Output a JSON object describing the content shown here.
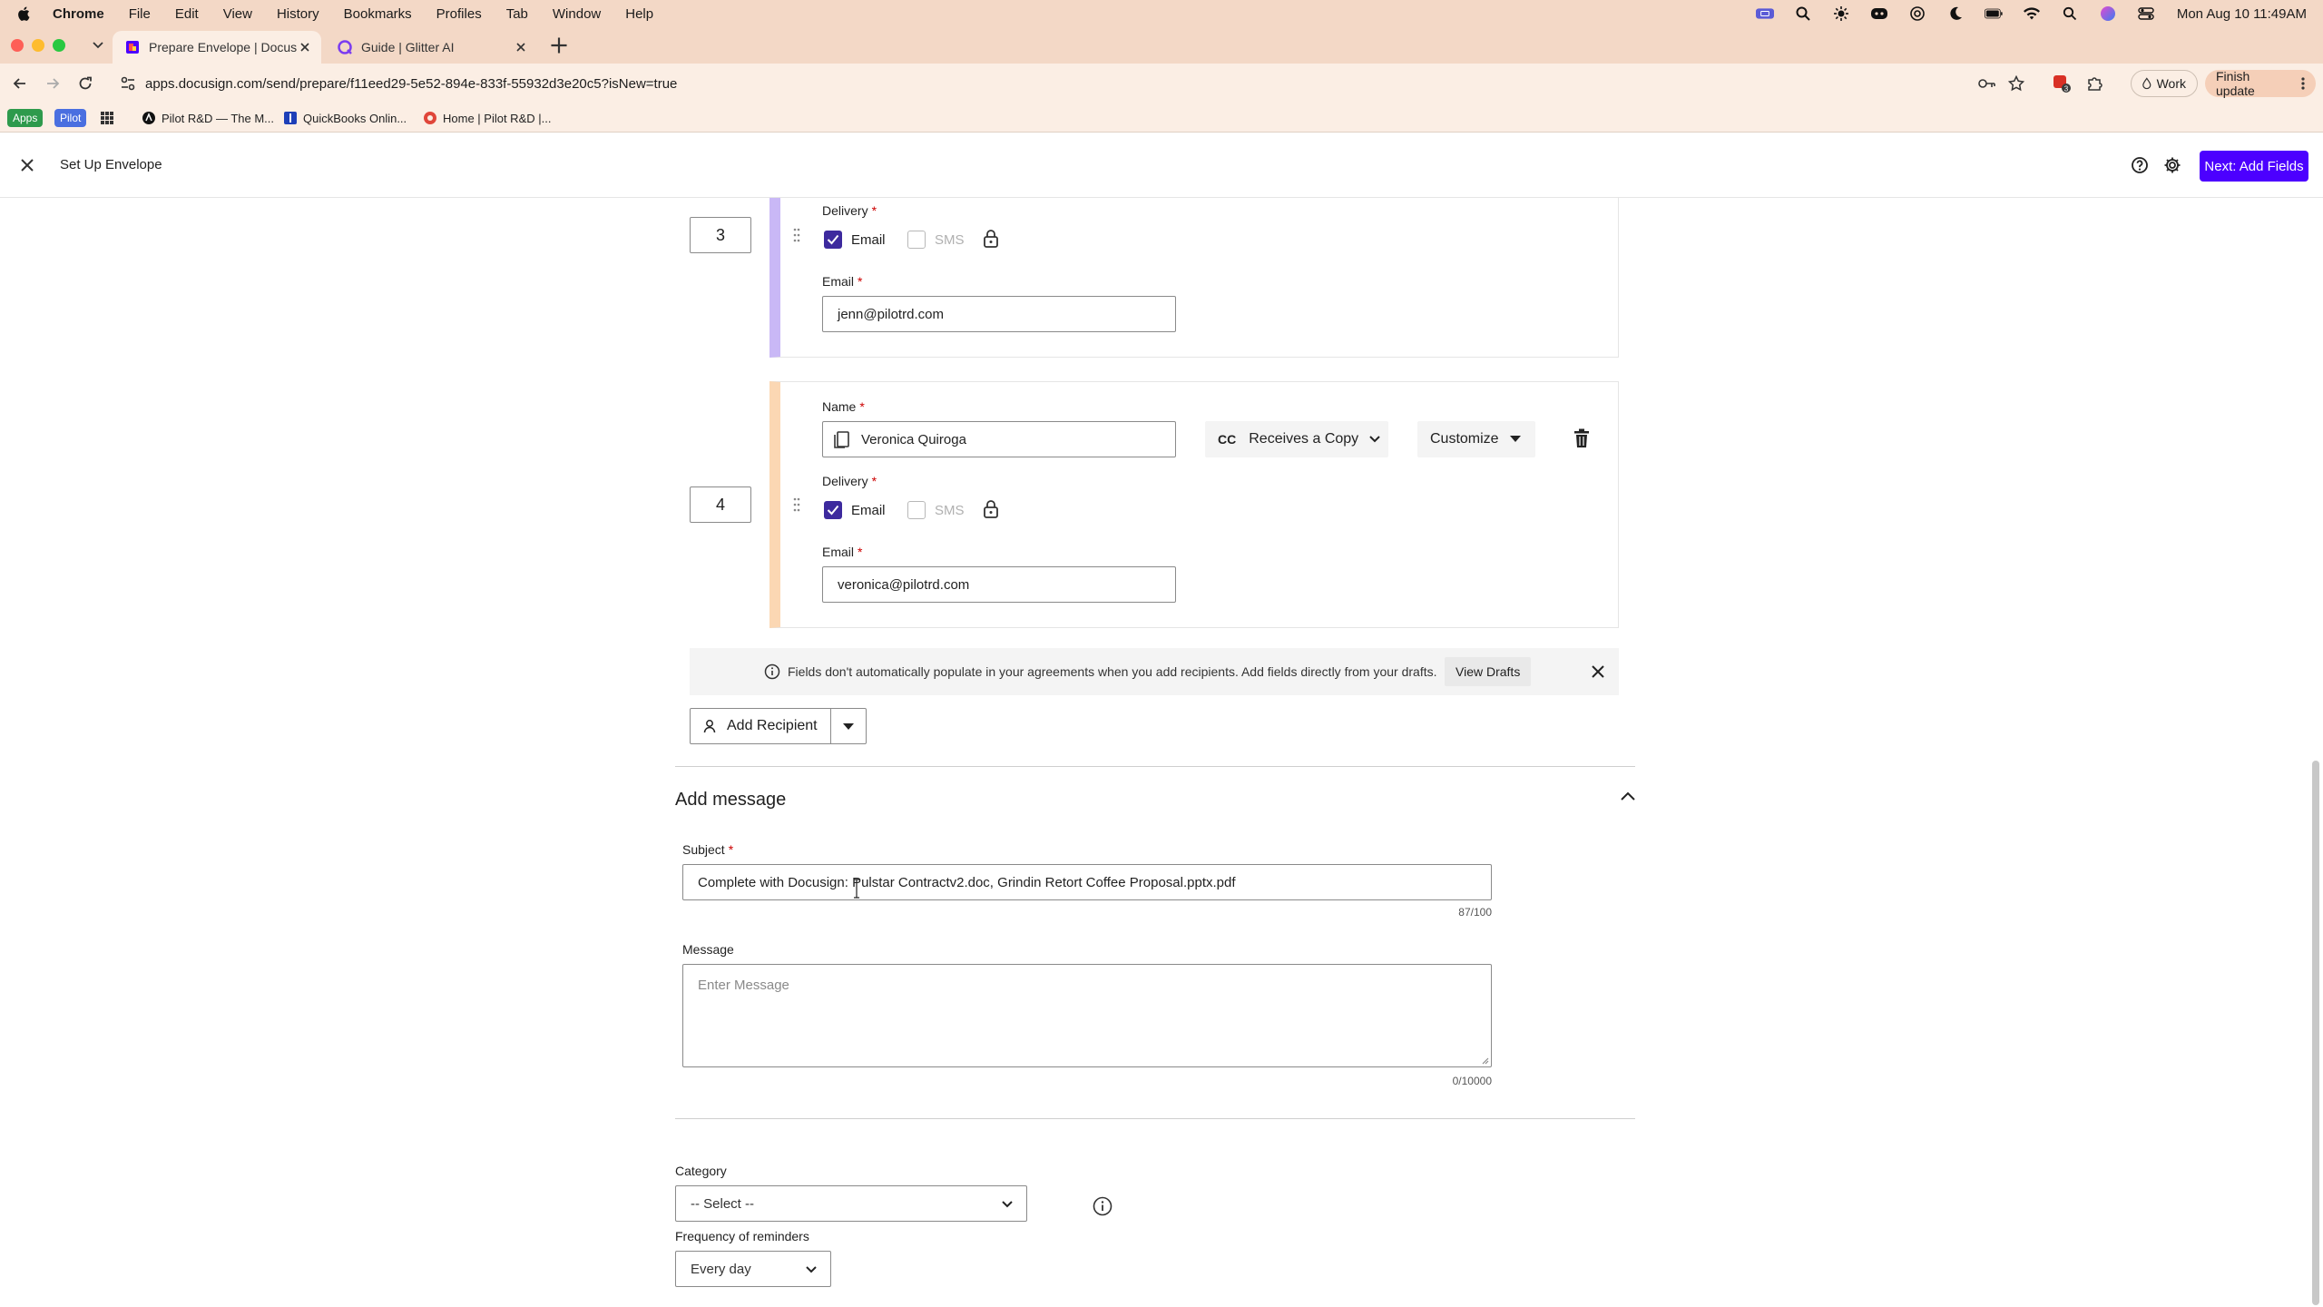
{
  "menubar": {
    "items": [
      "Chrome",
      "File",
      "Edit",
      "View",
      "History",
      "Bookmarks",
      "Profiles",
      "Tab",
      "Window",
      "Help"
    ],
    "ask_gemini": "Ask Gemini",
    "clock": "Mon Aug 10  11:49AM"
  },
  "browser": {
    "tabs": [
      {
        "title": "Prepare Envelope | Docusign",
        "active": true,
        "icon": "docusign-favicon"
      },
      {
        "title": "Guide | Glitter AI",
        "active": false,
        "icon": "glitter-favicon"
      }
    ],
    "url": "apps.docusign.com/send/prepare/f11eed29-5e52-894e-833f-55932d3e20c5?isNew=true",
    "profile_label": "Work",
    "update_label": "Finish update",
    "extension_badge": "3",
    "bookmarks": [
      {
        "label": "Apps",
        "type": "tag",
        "color": "#2e9a4c"
      },
      {
        "label": "Pilot",
        "type": "tag",
        "color": "#4a6fe0"
      },
      {
        "label": "Pilot R&D — The M...",
        "type": "link"
      },
      {
        "label": "QuickBooks Onlin...",
        "type": "link"
      },
      {
        "label": "Home | Pilot R&D |...",
        "type": "link"
      }
    ]
  },
  "header": {
    "title": "Set Up Envelope",
    "next_button": "Next: Add Fields"
  },
  "recipients": [
    {
      "order": "3",
      "delivery_label": "Delivery",
      "email_option": "Email",
      "sms_option": "SMS",
      "email_label": "Email",
      "email": "jenn@pilotrd.com"
    },
    {
      "order": "4",
      "name_label": "Name",
      "name": "Veronica Quiroga",
      "role_prefix": "CC",
      "role": "Receives a Copy",
      "customize": "Customize",
      "delivery_label": "Delivery",
      "email_option": "Email",
      "sms_option": "SMS",
      "email_label": "Email",
      "email": "veronica@pilotrd.com"
    }
  ],
  "notice": {
    "text": "Fields don't automatically populate in your agreements when you add recipients. Add fields directly from your drafts.",
    "link": "View Drafts"
  },
  "add_recipient": "Add Recipient",
  "message_section": {
    "title": "Add message",
    "subject_label": "Subject",
    "subject_value": "Complete with Docusign: Pulstar Contractv2.doc, Grindin Retort Coffee Proposal.pptx.pdf",
    "subject_count": "87/100",
    "message_label": "Message",
    "message_placeholder": "Enter Message",
    "message_count": "0/10000"
  },
  "options": {
    "category_label": "Category",
    "category_value": "-- Select --",
    "reminder_label": "Frequency of reminders",
    "reminder_value": "Every day"
  },
  "colors": {
    "accent": "#4c00ff",
    "checkbox": "#3d2a9e",
    "recipient3_bar": "#c9b8f6",
    "recipient4_bar": "#fbd7b3"
  }
}
